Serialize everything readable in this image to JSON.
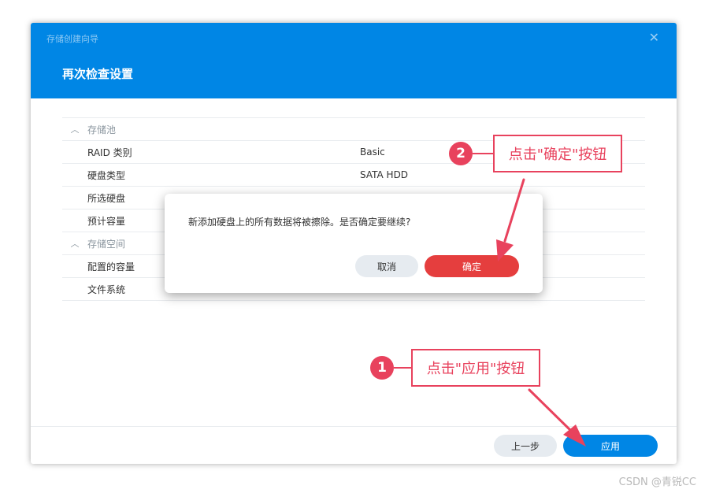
{
  "window": {
    "title": "存储创建向导",
    "close_glyph": "✕",
    "step_title": "再次检查设置"
  },
  "sections": [
    {
      "title": "存储池",
      "items": [
        {
          "label": "RAID 类别",
          "value": "Basic"
        },
        {
          "label": "硬盘类型",
          "value": "SATA HDD"
        },
        {
          "label": "所选硬盘",
          "value": ""
        },
        {
          "label": "预计容量",
          "value": ""
        }
      ]
    },
    {
      "title": "存储空间",
      "items": [
        {
          "label": "配置的容量",
          "value": ""
        },
        {
          "label": "文件系统",
          "value": ""
        }
      ]
    }
  ],
  "footer": {
    "prev_label": "上一步",
    "apply_label": "应用"
  },
  "dialog": {
    "message": "新添加硬盘上的所有数据将被擦除。是否确定要继续?",
    "cancel_label": "取消",
    "ok_label": "确定"
  },
  "annotations": [
    {
      "number": "1",
      "text": "点击\"应用\"按钮"
    },
    {
      "number": "2",
      "text": "点击\"确定\"按钮"
    }
  ],
  "watermark": "CSDN @青锐CC",
  "colors": {
    "header": "#0086e5",
    "primary_button": "#0086e5",
    "danger_button": "#e53e3e",
    "annotation": "#e8425d"
  },
  "icons": {
    "section_toggle": "chevron-up-icon",
    "close": "close-icon"
  }
}
